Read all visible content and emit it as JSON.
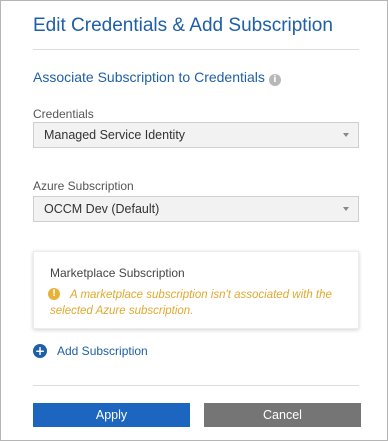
{
  "dialog": {
    "title": "Edit Credentials & Add Subscription",
    "section_heading": "Associate Subscription to Credentials",
    "info_icon": "i"
  },
  "credentials": {
    "label": "Credentials",
    "value": "Managed Service Identity"
  },
  "subscription": {
    "label": "Azure Subscription",
    "value": "OCCM Dev (Default)"
  },
  "marketplace": {
    "title": "Marketplace Subscription",
    "warning_icon": "!",
    "warning": "A marketplace subscription isn't associated with the selected Azure subscription."
  },
  "add_subscription": {
    "icon": "+",
    "label": "Add Subscription"
  },
  "footer": {
    "apply_label": "Apply",
    "cancel_label": "Cancel"
  },
  "colors": {
    "accent": "#1f5fa8",
    "primary_button": "#1d66c0",
    "secondary_button": "#757575",
    "warning": "#e0a92f"
  }
}
